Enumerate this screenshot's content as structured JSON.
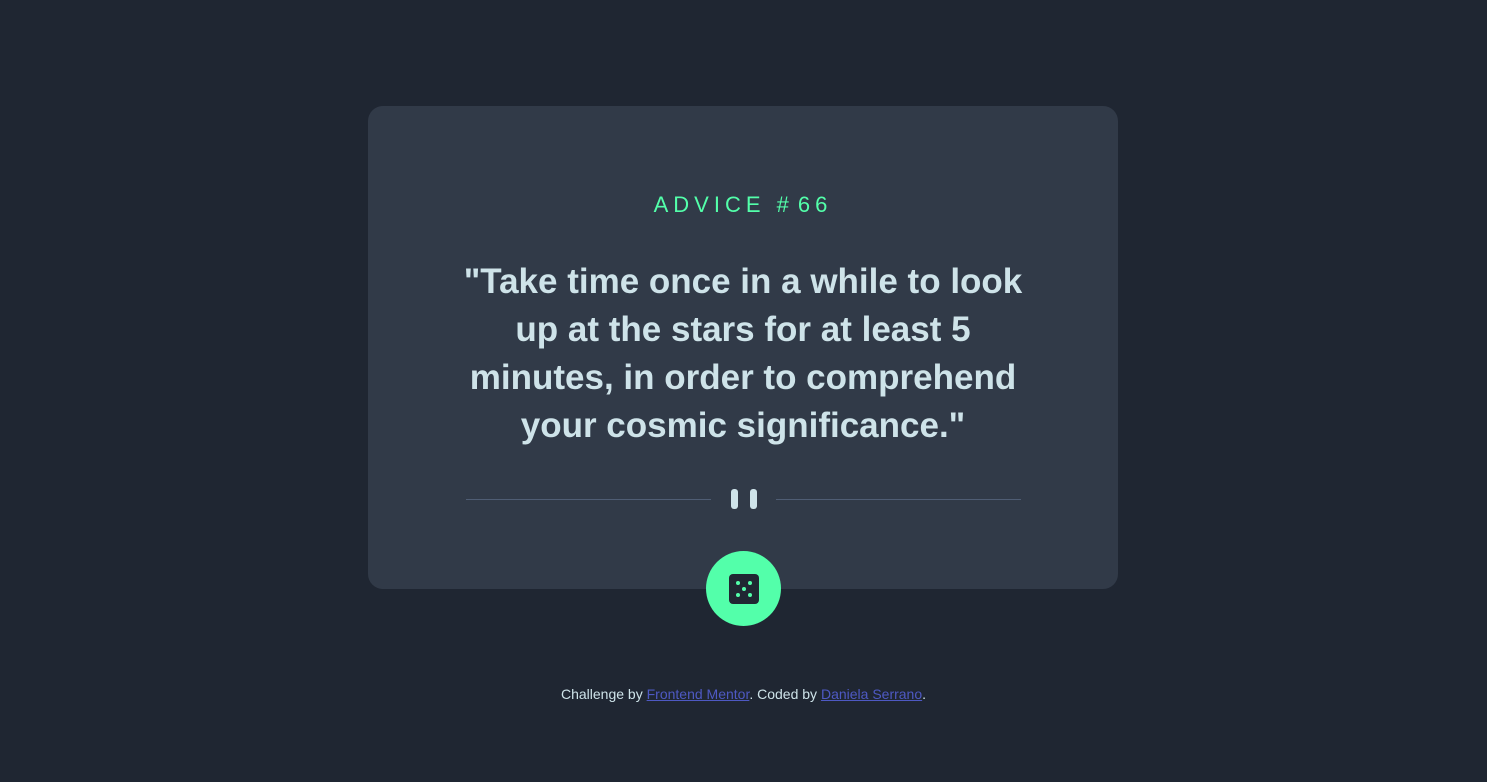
{
  "card": {
    "advice_label": "ADVICE #",
    "advice_number": "66",
    "quote": "\"Take time once in a while to look up at the stars for at least 5 minutes, in order to comprehend your cosmic significance.\""
  },
  "divider": {
    "icon": "pause-icon"
  },
  "dice_button": {
    "icon": "dice-icon"
  },
  "footer": {
    "prefix": "Challenge by ",
    "link1": "Frontend Mentor",
    "middle": ". Coded by ",
    "link2": "Daniela Serrano",
    "suffix": "."
  },
  "colors": {
    "background": "#1f2632",
    "card": "#313a48",
    "accent": "#53ffaa",
    "text": "#cee3e9",
    "link": "#4e59c3"
  }
}
